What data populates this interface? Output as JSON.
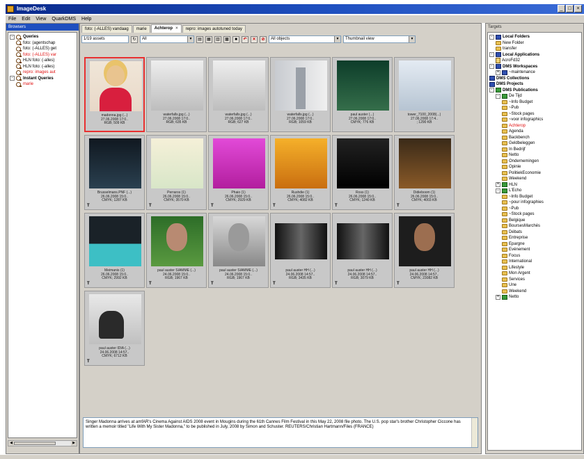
{
  "app": {
    "title": "ImageDesk"
  },
  "menu": [
    "File",
    "Edit",
    "View",
    "QuarkDMS",
    "Help"
  ],
  "left_panel": {
    "header": "Browsers",
    "tree": [
      {
        "label": "Queries",
        "level": 0,
        "bold": true,
        "expander": "-"
      },
      {
        "label": "foto: (agentschap",
        "level": 1
      },
      {
        "label": "foto: (-ALLES) get",
        "level": 1
      },
      {
        "label": "foto: (-ALLES) var",
        "level": 1,
        "red": true
      },
      {
        "label": "HLN foto: (-alles)",
        "level": 1
      },
      {
        "label": "HLN foto: (-alles)",
        "level": 1
      },
      {
        "label": "repro: images aut",
        "level": 1,
        "red": true
      },
      {
        "label": "Instant Queries",
        "level": 0,
        "bold": true,
        "expander": "-"
      },
      {
        "label": "marie",
        "level": 1,
        "red": true
      }
    ]
  },
  "tabs": [
    {
      "label": "foto: (-ALLES) vandaag",
      "active": false
    },
    {
      "label": "marie",
      "active": false
    },
    {
      "label": "Achterop",
      "active": true,
      "close": "×"
    },
    {
      "label": "repro: images autotuned today",
      "active": false
    }
  ],
  "toolbar": {
    "count": "1/19 assets",
    "filter_all": "All",
    "objects": "All objects",
    "view": "Thumbnail view"
  },
  "thumbnails": [
    {
      "style": "portrait-madonna",
      "selected": true,
      "caption": [
        "madonna.jpg (...)",
        "27.06.2008 17:0..",
        "RGB; 509 KB"
      ]
    },
    {
      "style": "photo-gray",
      "caption": [
        "waterfalls.jpg (...)",
        "27.06.2008 17:0..",
        "RGB; 635 KB"
      ]
    },
    {
      "style": "photo-gray",
      "caption": [
        "waterfalls.jpg (...)",
        "27.06.2008 17:0..",
        "RGB; 627 KB"
      ]
    },
    {
      "style": "tower",
      "caption": [
        "waterfalls.jpg (...)",
        "27.06.2008 17:0..",
        "RGB; 1059 KB"
      ]
    },
    {
      "style": "book-green",
      "caption": [
        "paul auster (...)",
        "27.06.2008 17:0..",
        "CMYK; 776 KB"
      ]
    },
    {
      "style": "book-skyline",
      "caption": [
        "tower_7100_2008(...)",
        "27.06.2008 17:4..",
        "; 1290 KB"
      ]
    },
    {
      "style": "book-dark",
      "flag": "T",
      "caption": [
        "Brusselmans.PNF (...)",
        "26.06.2008 15:0..",
        "CMYK; 1287 KB"
      ]
    },
    {
      "style": "book-cream",
      "flag": "T",
      "caption": [
        "Perraros (1)",
        "26.06.2008 15:0..",
        "CMYK; 3570 KB"
      ]
    },
    {
      "style": "book-magenta",
      "flag": "T",
      "caption": [
        "Phaio (1)",
        "26.06.2008 15:0..",
        "CMYK; 2929 KB"
      ]
    },
    {
      "style": "book-yellow",
      "flag": "T",
      "caption": [
        "Rushdie (1)",
        "26.06.2008 15:0..",
        "CMYK; 4082 KB"
      ]
    },
    {
      "style": "book-black",
      "flag": "T",
      "caption": [
        "Ross (1)",
        "26.06.2008 15:0..",
        "CMYK; 1240 KB"
      ]
    },
    {
      "style": "book-brown",
      "flag": "T",
      "caption": [
        "Didieboom (1)",
        "26.06.2008 15:0..",
        "CMYK; 4003 KB"
      ]
    },
    {
      "style": "book-teal",
      "flag": "T",
      "caption": [
        "Meimanis (1)",
        "26.06.2008 15:0..",
        "CMYK; 2992 KB"
      ]
    },
    {
      "style": "face-green",
      "flag": "T",
      "caption": [
        "paul auster SIAMME (...)",
        "24.06.2008 15:0..",
        "RGB; 1967 KB"
      ]
    },
    {
      "style": "face-bw",
      "flag": "T",
      "caption": [
        "paul auster SIAMME (...)",
        "24.06.2008 15:0..",
        "RGB; 1967 KB"
      ]
    },
    {
      "style": "wide-dark",
      "flag": "T",
      "caption": [
        "paul auster HH (...)",
        "24.06.2008 14:57..",
        "RGB; 3435 KB"
      ]
    },
    {
      "style": "wide-dark",
      "flag": "T",
      "caption": [
        "paul auster HH (...)",
        "24.06.2008 14:57..",
        "RGB; 3079 KB"
      ]
    },
    {
      "style": "face-dark",
      "flag": "T",
      "caption": [
        "paul auster HH (...)",
        "24.06.2008 14:57..",
        "CMYK; 23082 KB"
      ]
    },
    {
      "style": "hat",
      "flag": "T",
      "caption": [
        "paul auster IDIA (...)",
        "24.06.2008 14:57..",
        "CMYK; 6712 KB"
      ]
    }
  ],
  "description": "Singer Madonna arrives at amfAR's Cinema Against AIDS 2008 event in Mougins during the 61th Cannes Film Festival in this May 22, 2008 file photo. The U.S. pop star's brother Christopher Ciccone has written a memoir titled \"Life With My Sister Madonna,\" to be published in July, 2008 by Simon and Schuster. REUTERS/Christian Hartmann/Files (FRANCE)",
  "right_panel": {
    "header": "Targets",
    "tree": [
      {
        "label": "Local Folders",
        "level": 0,
        "bold": true,
        "icon": "sicon",
        "expander": "-"
      },
      {
        "label": "New Folder",
        "level": 1,
        "icon": "ficon"
      },
      {
        "label": "transfer",
        "level": 1,
        "icon": "ficon"
      },
      {
        "label": "Local Applications",
        "level": 0,
        "bold": true,
        "icon": "sicon",
        "expander": "-"
      },
      {
        "label": "AcroFd32",
        "level": 1,
        "icon": "picon"
      },
      {
        "label": "DMS Workspaces",
        "level": 0,
        "bold": true,
        "icon": "sicon",
        "expander": "-"
      },
      {
        "label": "~maintenance",
        "level": 1,
        "icon": "sicon",
        "expander": "+"
      },
      {
        "label": "DMS Collections",
        "level": 0,
        "bold": true,
        "icon": "sicon"
      },
      {
        "label": "DMS Projects",
        "level": 0,
        "bold": true,
        "icon": "sicon"
      },
      {
        "label": "DMS Publications",
        "level": 0,
        "bold": true,
        "icon": "gicon",
        "expander": "-"
      },
      {
        "label": "De Tijd",
        "level": 1,
        "icon": "gicon",
        "expander": "-"
      },
      {
        "label": "~Info Budget",
        "level": 2,
        "icon": "ficon"
      },
      {
        "label": "~Pub",
        "level": 2,
        "icon": "ficon"
      },
      {
        "label": "~Stock pages",
        "level": 2,
        "icon": "ficon"
      },
      {
        "label": "~voor infographics",
        "level": 2,
        "icon": "ficon"
      },
      {
        "label": "Achterop",
        "level": 2,
        "icon": "ficon",
        "red": true
      },
      {
        "label": "Agenda",
        "level": 2,
        "icon": "ficon"
      },
      {
        "label": "Backbench",
        "level": 2,
        "icon": "ficon"
      },
      {
        "label": "Geldbeleggen",
        "level": 2,
        "icon": "ficon"
      },
      {
        "label": "In Bedrijf",
        "level": 2,
        "icon": "ficon"
      },
      {
        "label": "Netto",
        "level": 2,
        "icon": "ficon"
      },
      {
        "label": "Ondernemingen",
        "level": 2,
        "icon": "ficon"
      },
      {
        "label": "Opinie",
        "level": 2,
        "icon": "ficon"
      },
      {
        "label": "PolitiekEconomie",
        "level": 2,
        "icon": "ficon"
      },
      {
        "label": "Weekend",
        "level": 2,
        "icon": "ficon"
      },
      {
        "label": "HLN",
        "level": 1,
        "icon": "gicon",
        "expander": "+"
      },
      {
        "label": "L'Echo",
        "level": 1,
        "icon": "gicon",
        "expander": "-"
      },
      {
        "label": "~Info Budget",
        "level": 2,
        "icon": "ficon"
      },
      {
        "label": "~pour infographies",
        "level": 2,
        "icon": "ficon"
      },
      {
        "label": "~Pub",
        "level": 2,
        "icon": "ficon"
      },
      {
        "label": "~Stock pages",
        "level": 2,
        "icon": "ficon"
      },
      {
        "label": "Belgique",
        "level": 2,
        "icon": "ficon"
      },
      {
        "label": "BoursesMarchés",
        "level": 2,
        "icon": "ficon"
      },
      {
        "label": "Débats",
        "level": 2,
        "icon": "ficon"
      },
      {
        "label": "Entreprise",
        "level": 2,
        "icon": "ficon"
      },
      {
        "label": "Epargne",
        "level": 2,
        "icon": "ficon"
      },
      {
        "label": "Evénement",
        "level": 2,
        "icon": "ficon"
      },
      {
        "label": "Focus",
        "level": 2,
        "icon": "ficon"
      },
      {
        "label": "International",
        "level": 2,
        "icon": "ficon"
      },
      {
        "label": "Lifestyle",
        "level": 2,
        "icon": "ficon"
      },
      {
        "label": "Mon Argent",
        "level": 2,
        "icon": "ficon"
      },
      {
        "label": "Services",
        "level": 2,
        "icon": "ficon"
      },
      {
        "label": "Une",
        "level": 2,
        "icon": "ficon"
      },
      {
        "label": "Weekend",
        "level": 2,
        "icon": "ficon"
      },
      {
        "label": "Netto",
        "level": 1,
        "icon": "gicon",
        "expander": "+"
      }
    ]
  }
}
